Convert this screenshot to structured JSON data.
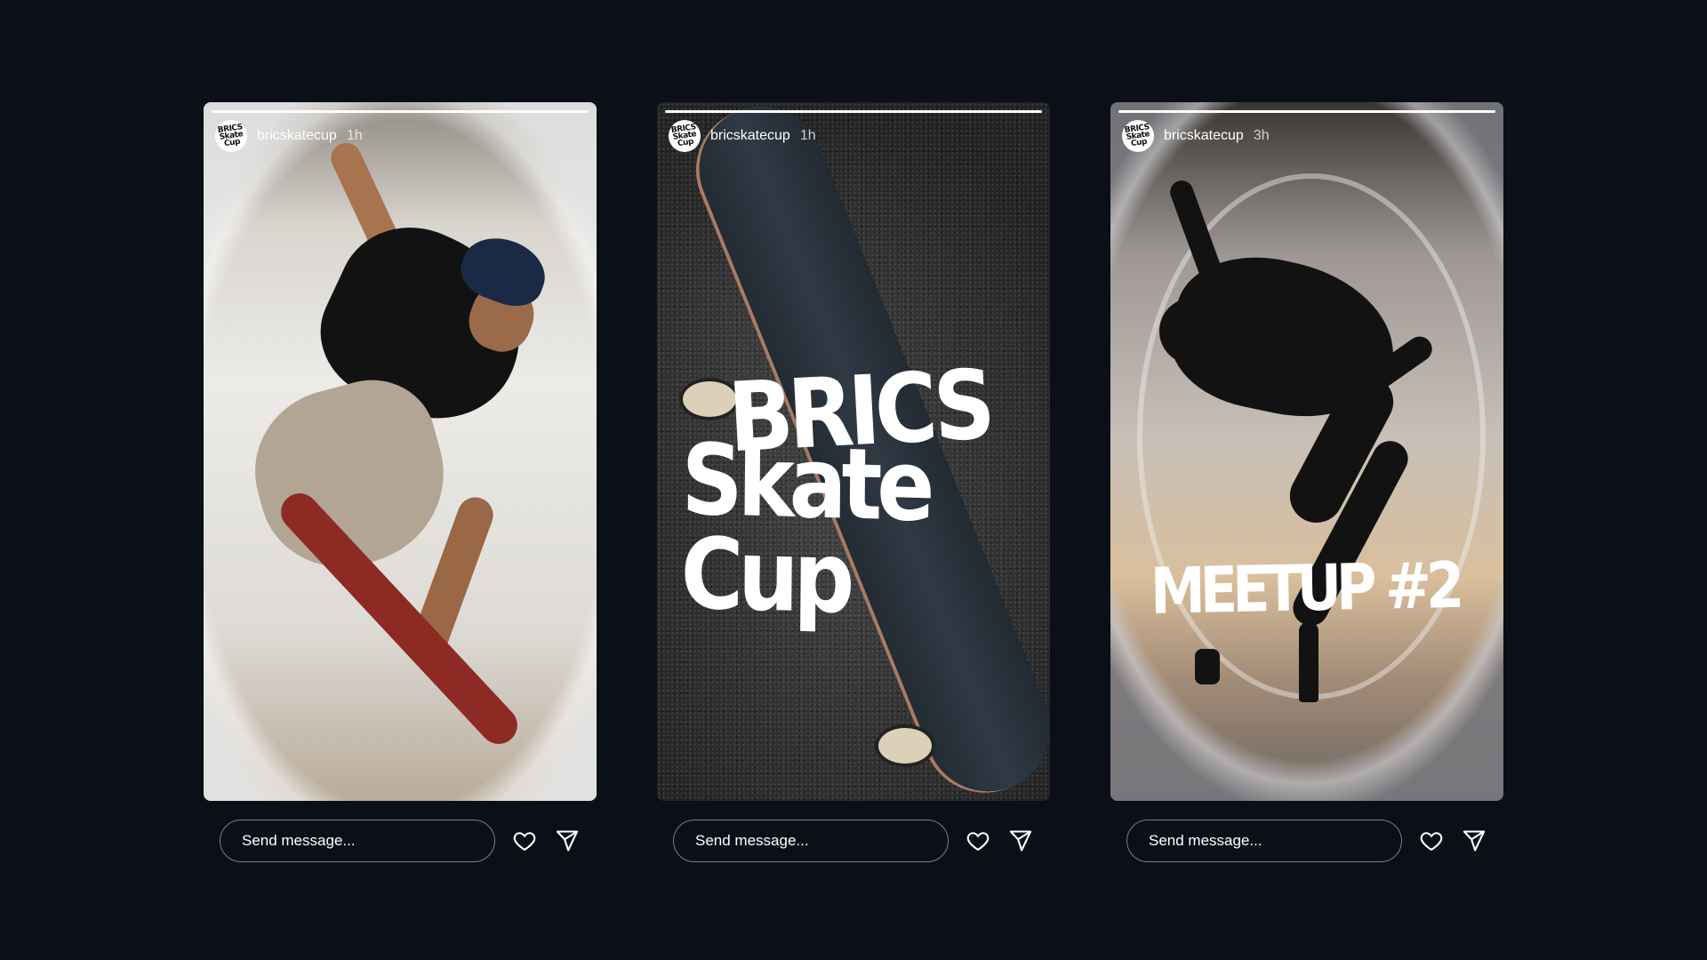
{
  "stories": [
    {
      "username": "bricskatecup",
      "timestamp": "1h",
      "avatar_text": "BRICS Skate Cup",
      "progress": 1.0,
      "overlay_text": "",
      "message_placeholder": "Send message..."
    },
    {
      "username": "bricskatecup",
      "timestamp": "1h",
      "avatar_text": "BRICS Skate Cup",
      "progress": 1.0,
      "overlay_text_line1": "BRICS",
      "overlay_text_line2": "Skate Cup",
      "message_placeholder": "Send message..."
    },
    {
      "username": "bricskatecup",
      "timestamp": "3h",
      "avatar_text": "BRICS Skate Cup",
      "progress": 1.0,
      "overlay_text": "MEETUP #2",
      "message_placeholder": "Send message..."
    }
  ],
  "icons": {
    "like": "heart-icon",
    "share": "send-icon"
  },
  "colors": {
    "background": "#0b0f17",
    "input_border": "#7a7d84",
    "text": "#ffffff"
  }
}
